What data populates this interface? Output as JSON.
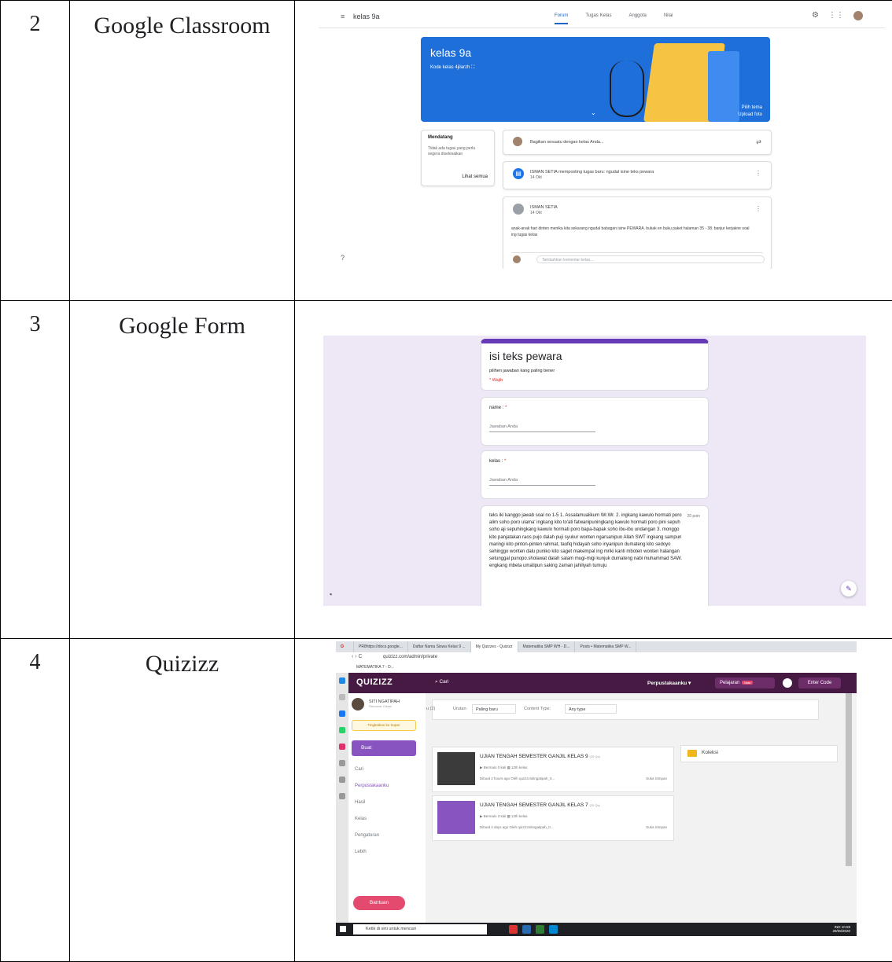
{
  "rows": [
    {
      "num": "2",
      "app": "Google Classroom"
    },
    {
      "num": "3",
      "app": "Google Form"
    },
    {
      "num": "4",
      "app": "Quizizz"
    }
  ],
  "classroom": {
    "class_name": "kelas 9a",
    "tabs": [
      "Forum",
      "Tugas Kelas",
      "Anggota",
      "Nilai"
    ],
    "banner_title": "kelas 9a",
    "class_code": "Kode kelas  4jilarzh ⛶",
    "banner_links": [
      "Pilih tema",
      "Upload foto"
    ],
    "upcoming_title": "Mendatang",
    "upcoming_text": "Tidak ada tugas yang perlu segera diselesaikan",
    "see_all": "Lihat semua",
    "share_placeholder": "Bagikan sesuatu dengan kelas Anda...",
    "post1_text": "ISMAN SETIA memposting tugas baru: ngudal isine teks pewara",
    "post1_date": "14 Okt",
    "post2_author": "ISMAN SETIA",
    "post2_date": "14 Okt",
    "post2_body": "anak-anak hari dinten menika kita sekarang ngudal babagan isine PEWARA. bukak en buku paket halaman 35 - 38. banjur kerjakne soal ing tugas kelas",
    "comment_placeholder": "Tambahkan komentar kelas..."
  },
  "form": {
    "title": "isi teks pewara",
    "description": "pilihen jawaban kang paling bener",
    "required_note": "* Wajib",
    "q1_label": "name :",
    "q2_label": "kelas :",
    "required_mark": "*",
    "answer_placeholder": "Jawaban Anda",
    "points": "20 poin",
    "q3_text": "teks iki kanggo jawab soal no 1-5 1. Assalamualikum Wr.Wr. 2. ingkang kawulo hormati poro alim soho poro ulama' ingkang kito to'ati fatwanipuningkang kawulo hormati poro pini sepuh soho aji sepuhingkang kawulo hormati poro bapa-bapak soho ibu-ibu undangan 3. monggo kito panjatakan raos pujo dalah puji syukur wonten ngarsanipun Allah SWT ingkang sampun maringi kito pinton-pinten rahmat, taufiq hidayah soho inyanipun dumateng kito sedoyo sehinggo wonten dalu puniko kito saget makempal ing mriki kanti mboten wonten halangan setunggal punopo.sholawat dalah salam mugi-migi kunjuk dumateng nabi muhammad SAW. engkang mbeta umatipun saking zaman jahiliyah tumuju"
  },
  "quizizz": {
    "browser_tabs": [
      "PR8https://docs.google...",
      "Daftar Nama Siswa Kelas 9 ...",
      "My Quizzes - Quizizz",
      "Matematika SMP WH - D...",
      "Posts • Matematika SMP W..."
    ],
    "url": "quizizz.com/admin/private",
    "bookmark": "MATEMATIKA 7 - D...",
    "logo": "QUIZIZZ",
    "search": "Cari",
    "library": "Perpustakaanku ▾",
    "lessons": "Pelajaran",
    "new_badge": "baru",
    "enter_code": "Enter Code",
    "user_name": "SITI NGATIPAH",
    "user_plan": "Rencana: Dasar",
    "upgrade": "Tingkatkan ke Super",
    "create": "Buat",
    "nav": [
      "Cari",
      "Perpustakaanku",
      "Hasil",
      "Kelas",
      "Pengaturan",
      "Lebih"
    ],
    "help": "Bantuan",
    "filter_count": "u (2)",
    "sort_label": "Urutan:",
    "sort_value": "Paling baru",
    "content_label": "Content Type:",
    "content_value": "Any type",
    "quizzes": [
      {
        "title": "UJIAN TENGAH SEMESTER GANJIL KELAS 9",
        "qs": "(20 Qs)",
        "played": "Bermain 0 kali",
        "grade": "12th kelas",
        "by": "Dibuat 2 hours ago Oleh quizizzsitingatipah_0...",
        "like": "Suka",
        "save": "Simpan"
      },
      {
        "title": "UJIAN TENGAH SEMESTER GANJIL KELAS 7",
        "qs": "(20 Qs)",
        "played": "Bermain 3 kali",
        "grade": "12th kelas",
        "by": "Dibuat 4 days ago Oleh quizizzsitingatipah_0...",
        "like": "Suka",
        "save": "Simpan"
      }
    ],
    "collection": "Koleksi",
    "taskbar_search": "Ketik di sini untuk mencari",
    "time": "10.59",
    "date": "28/08/2020",
    "lang": "IND"
  },
  "colors": {
    "classroom_blue": "#1e6fd9",
    "form_purple": "#673ab7",
    "quizizz_header": "#461a42",
    "quizizz_purple": "#8854c0"
  }
}
